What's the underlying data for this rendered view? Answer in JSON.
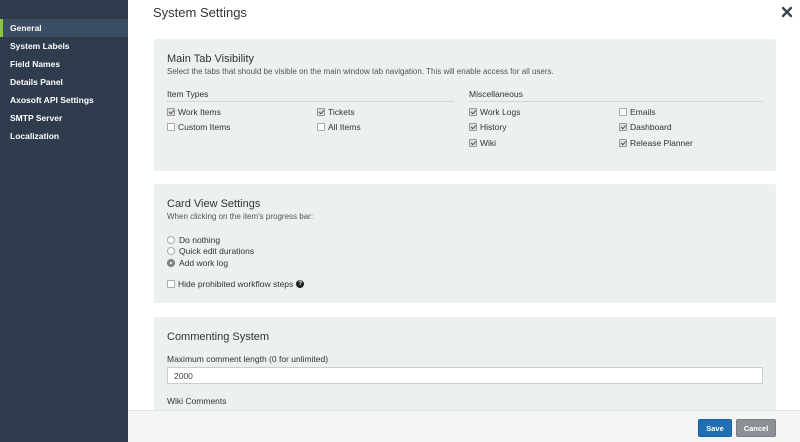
{
  "sidebar": {
    "items": [
      {
        "label": "General",
        "active": true
      },
      {
        "label": "System Labels"
      },
      {
        "label": "Field Names"
      },
      {
        "label": "Details Panel"
      },
      {
        "label": "Axosoft API Settings"
      },
      {
        "label": "SMTP Server"
      },
      {
        "label": "Localization"
      }
    ]
  },
  "header": {
    "title": "System Settings",
    "close_icon": "close-x-icon"
  },
  "main_tab": {
    "title": "Main Tab Visibility",
    "description": "Select the tabs that should be visible on the main window tab navigation. This will enable access for all users.",
    "item_types_heading": "Item Types",
    "misc_heading": "Miscellaneous",
    "options": {
      "work_items": {
        "label": "Work Items",
        "checked": true
      },
      "tickets": {
        "label": "Tickets",
        "checked": true
      },
      "custom_items": {
        "label": "Custom Items",
        "checked": false
      },
      "all_items": {
        "label": "All Items",
        "checked": false
      },
      "work_logs": {
        "label": "Work Logs",
        "checked": true
      },
      "emails": {
        "label": "Emails",
        "checked": false
      },
      "history": {
        "label": "History",
        "checked": true
      },
      "dashboard": {
        "label": "Dashboard",
        "checked": true
      },
      "wiki": {
        "label": "Wiki",
        "checked": true
      },
      "release_planner": {
        "label": "Release Planner",
        "checked": true
      }
    }
  },
  "card_view": {
    "title": "Card View Settings",
    "description": "When clicking on the item's progress bar:",
    "radios": [
      {
        "label": "Do nothing",
        "selected": false
      },
      {
        "label": "Quick edit durations",
        "selected": false
      },
      {
        "label": "Add work log",
        "selected": true
      }
    ],
    "hide_prohibited": {
      "label": "Hide prohibited workflow steps",
      "checked": false
    },
    "help_icon": "question-circle-icon",
    "help_glyph": "?"
  },
  "commenting": {
    "title": "Commenting System",
    "max_length_label": "Maximum comment length (0 for unlimited)",
    "max_length_value": "2000",
    "wiki_comments_label": "Wiki Comments"
  },
  "footer": {
    "save_label": "Save",
    "cancel_label": "Cancel"
  },
  "colors": {
    "sidebar_bg": "#2e3c4e",
    "active_accent": "#8cc63f",
    "save_blue": "#1f6fb2",
    "cancel_gray": "#8c9094",
    "panel_bg": "#edf0f0"
  }
}
